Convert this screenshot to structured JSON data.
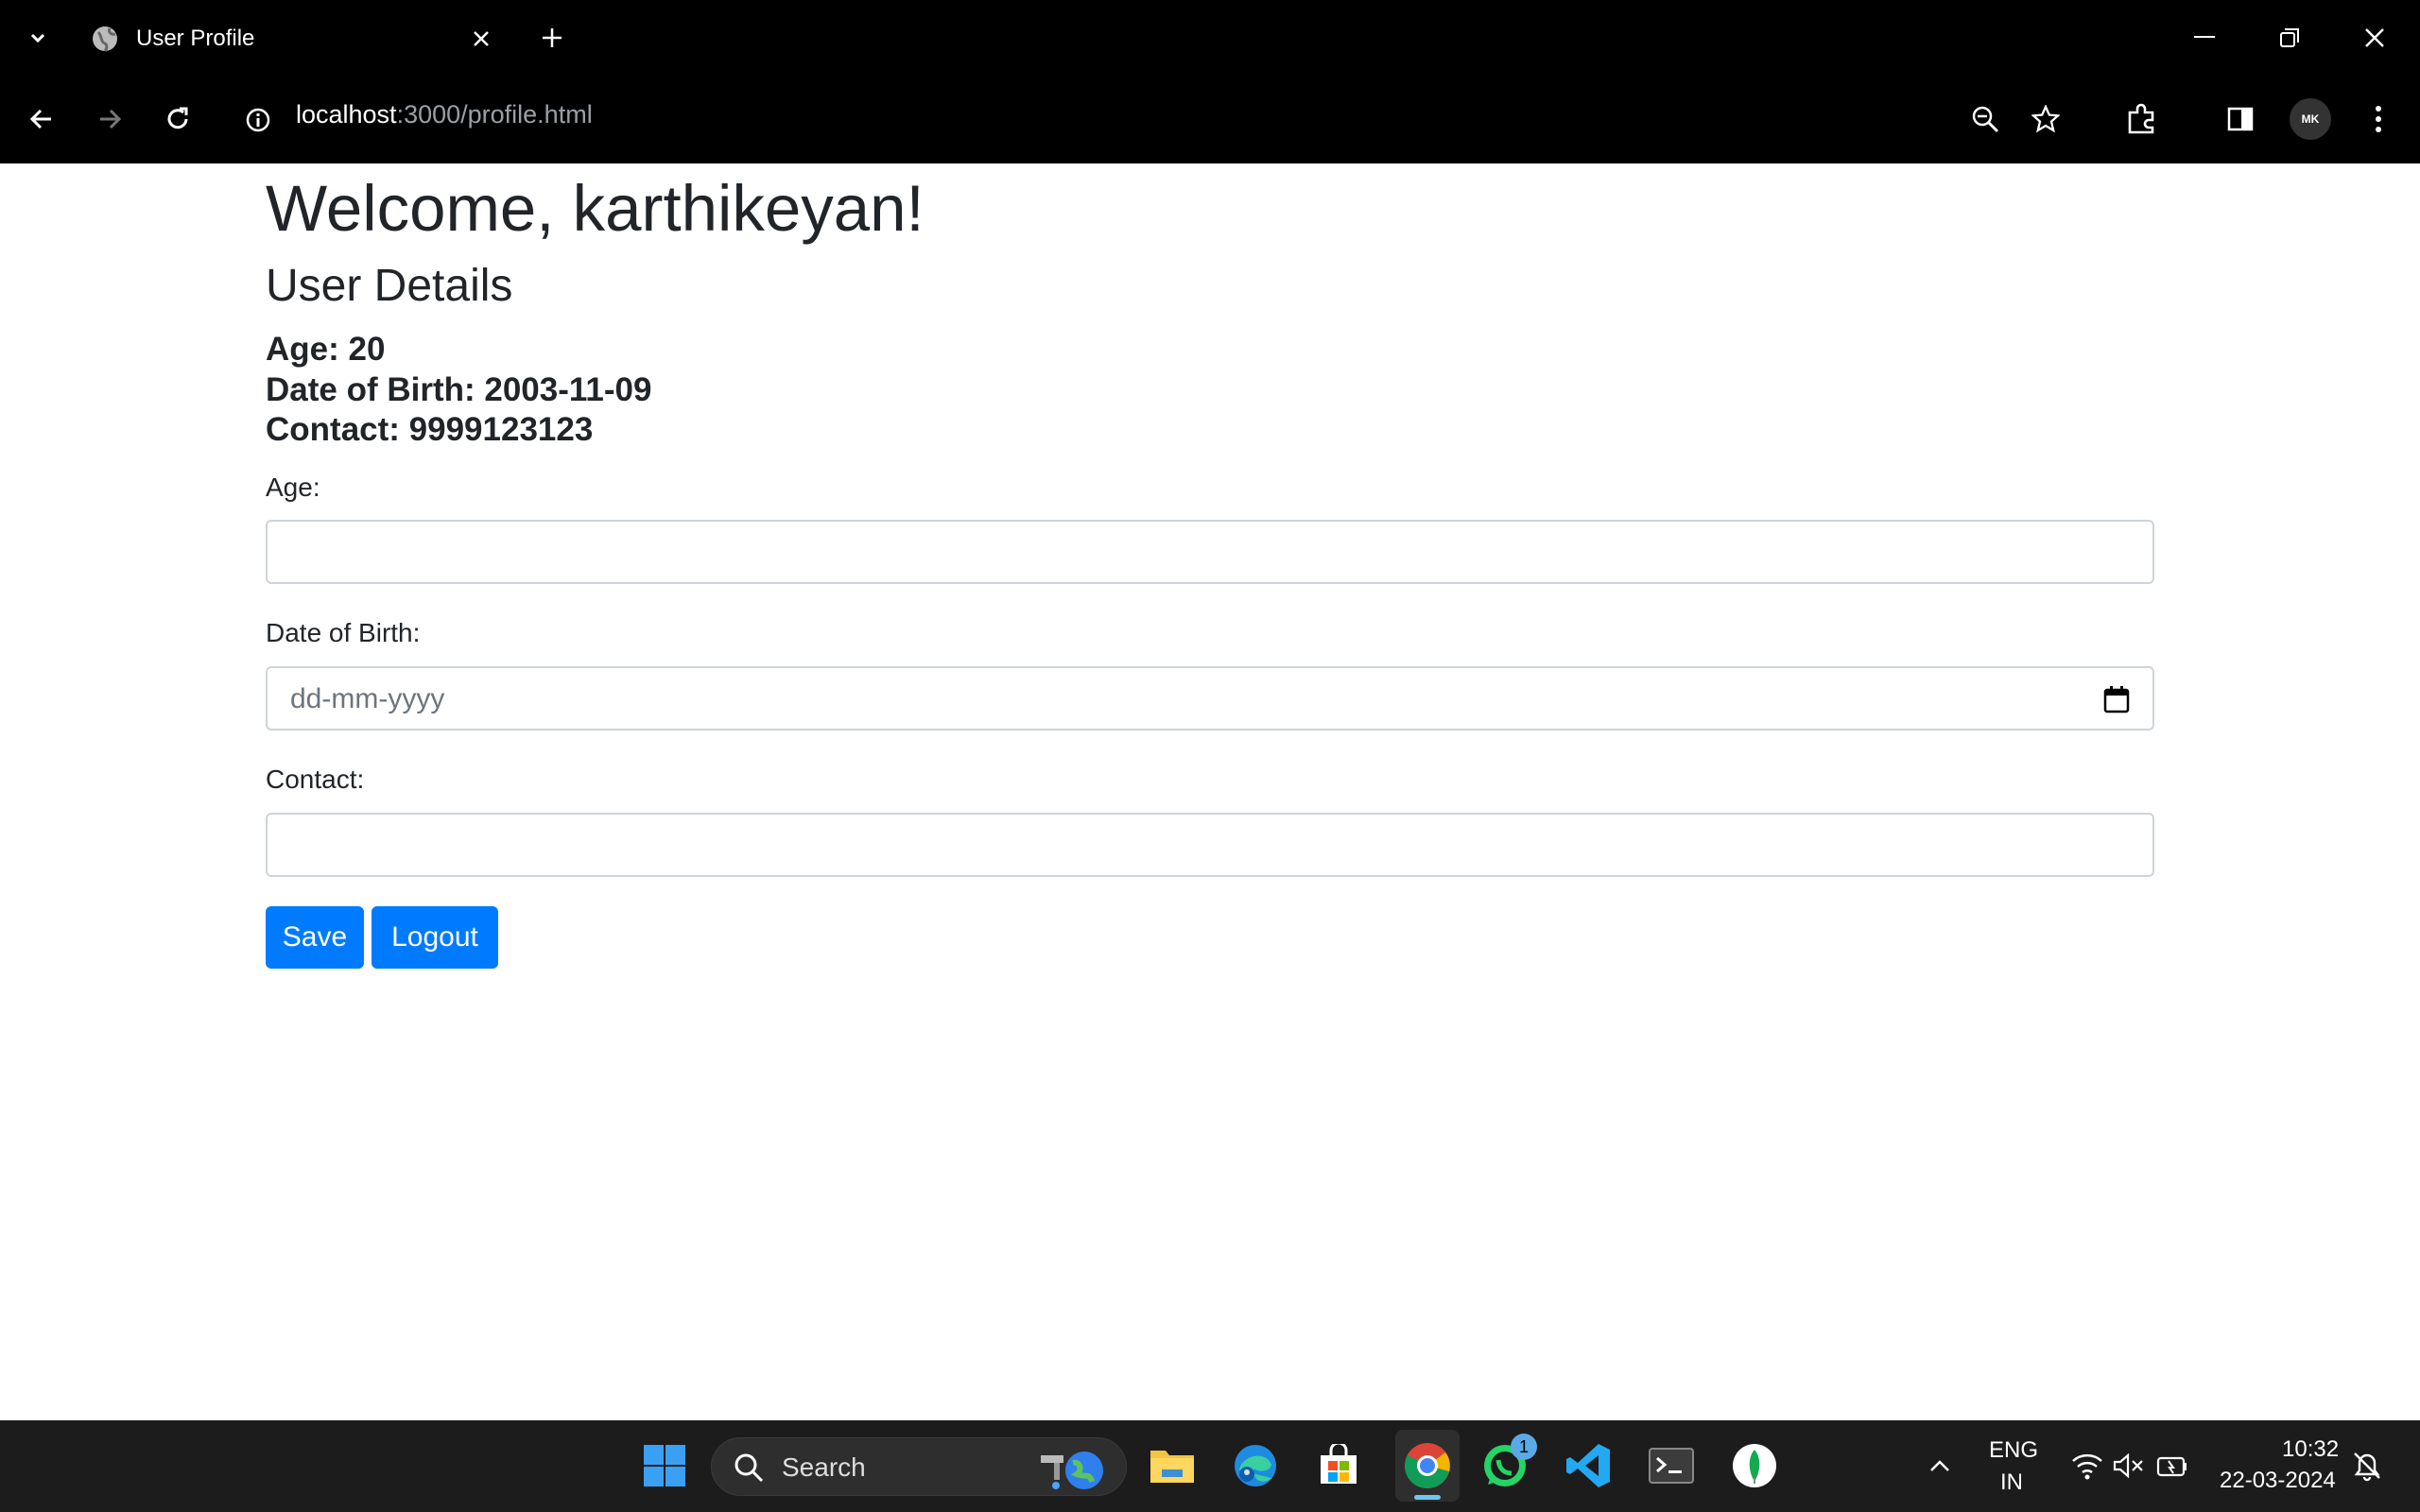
{
  "browser": {
    "tab_title": "User Profile",
    "url_host": "localhost",
    "url_path": ":3000/profile.html",
    "profile_initials": "MK"
  },
  "page": {
    "welcome": "Welcome, karthikeyan!",
    "section_title": "User Details",
    "details": {
      "age": "Age: 20",
      "dob": "Date of Birth: 2003-11-09",
      "contact": "Contact: 9999123123"
    },
    "form": {
      "age_label": "Age:",
      "age_value": "",
      "dob_label": "Date of Birth:",
      "dob_placeholder": "dd-mm-yyyy",
      "contact_label": "Contact:",
      "contact_value": "",
      "save_label": "Save",
      "logout_label": "Logout"
    }
  },
  "taskbar": {
    "search_placeholder": "Search",
    "whatsapp_badge": "1",
    "lang_top": "ENG",
    "lang_bottom": "IN",
    "time": "10:32",
    "date": "22-03-2024"
  },
  "colors": {
    "primary": "#007bff",
    "browser_bg": "#000000",
    "taskbar_bg": "#1c1c1c"
  }
}
